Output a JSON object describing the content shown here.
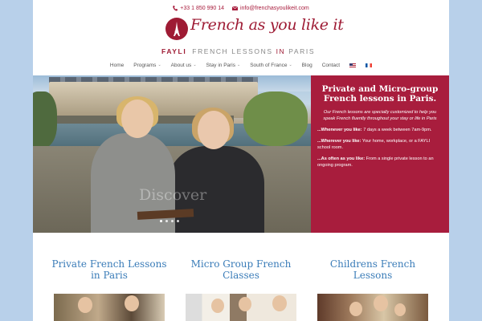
{
  "contact": {
    "phone": "+33 1 850 990 14",
    "email": "info@frenchasyoulikeit.com"
  },
  "logo": {
    "script_text": "French as you like it",
    "brand": "FAYLI",
    "tagline_part1": "FRENCH LESSONS",
    "tagline_in": "IN",
    "tagline_part2": "PARIS"
  },
  "nav": {
    "items": [
      {
        "label": "Home",
        "dropdown": false
      },
      {
        "label": "Programs",
        "dropdown": true
      },
      {
        "label": "About us",
        "dropdown": true
      },
      {
        "label": "Stay in Paris",
        "dropdown": true
      },
      {
        "label": "South of France",
        "dropdown": true
      },
      {
        "label": "Blog",
        "dropdown": false
      },
      {
        "label": "Contact",
        "dropdown": false
      }
    ],
    "languages": [
      "english-flag-icon",
      "french-flag-icon"
    ]
  },
  "hero": {
    "overlay_text": "Discover",
    "slide_count": 4,
    "active_slide": 1
  },
  "panel": {
    "title": "Private and Micro-group French lessons in Paris.",
    "intro": "Our French lessons are specially customized to help you speak French fluently throughout your stay or life in Paris",
    "bullets": [
      {
        "label": "...Whenever you like:",
        "text": " 7 days a week between 7am-9pm."
      },
      {
        "label": "...Wherever you like:",
        "text": " Your home, workplace, or a FAYLI school room."
      },
      {
        "label": "...As often as you like:",
        "text": " From a single private lesson to an ongoing program."
      }
    ]
  },
  "services": [
    {
      "title": "Private French Lessons in Paris"
    },
    {
      "title": "Micro Group French Classes"
    },
    {
      "title": "Childrens French Lessons"
    }
  ],
  "colors": {
    "brand_red": "#a81d3d",
    "link_blue": "#3a7cb8",
    "page_bg": "#b8d0ea"
  }
}
